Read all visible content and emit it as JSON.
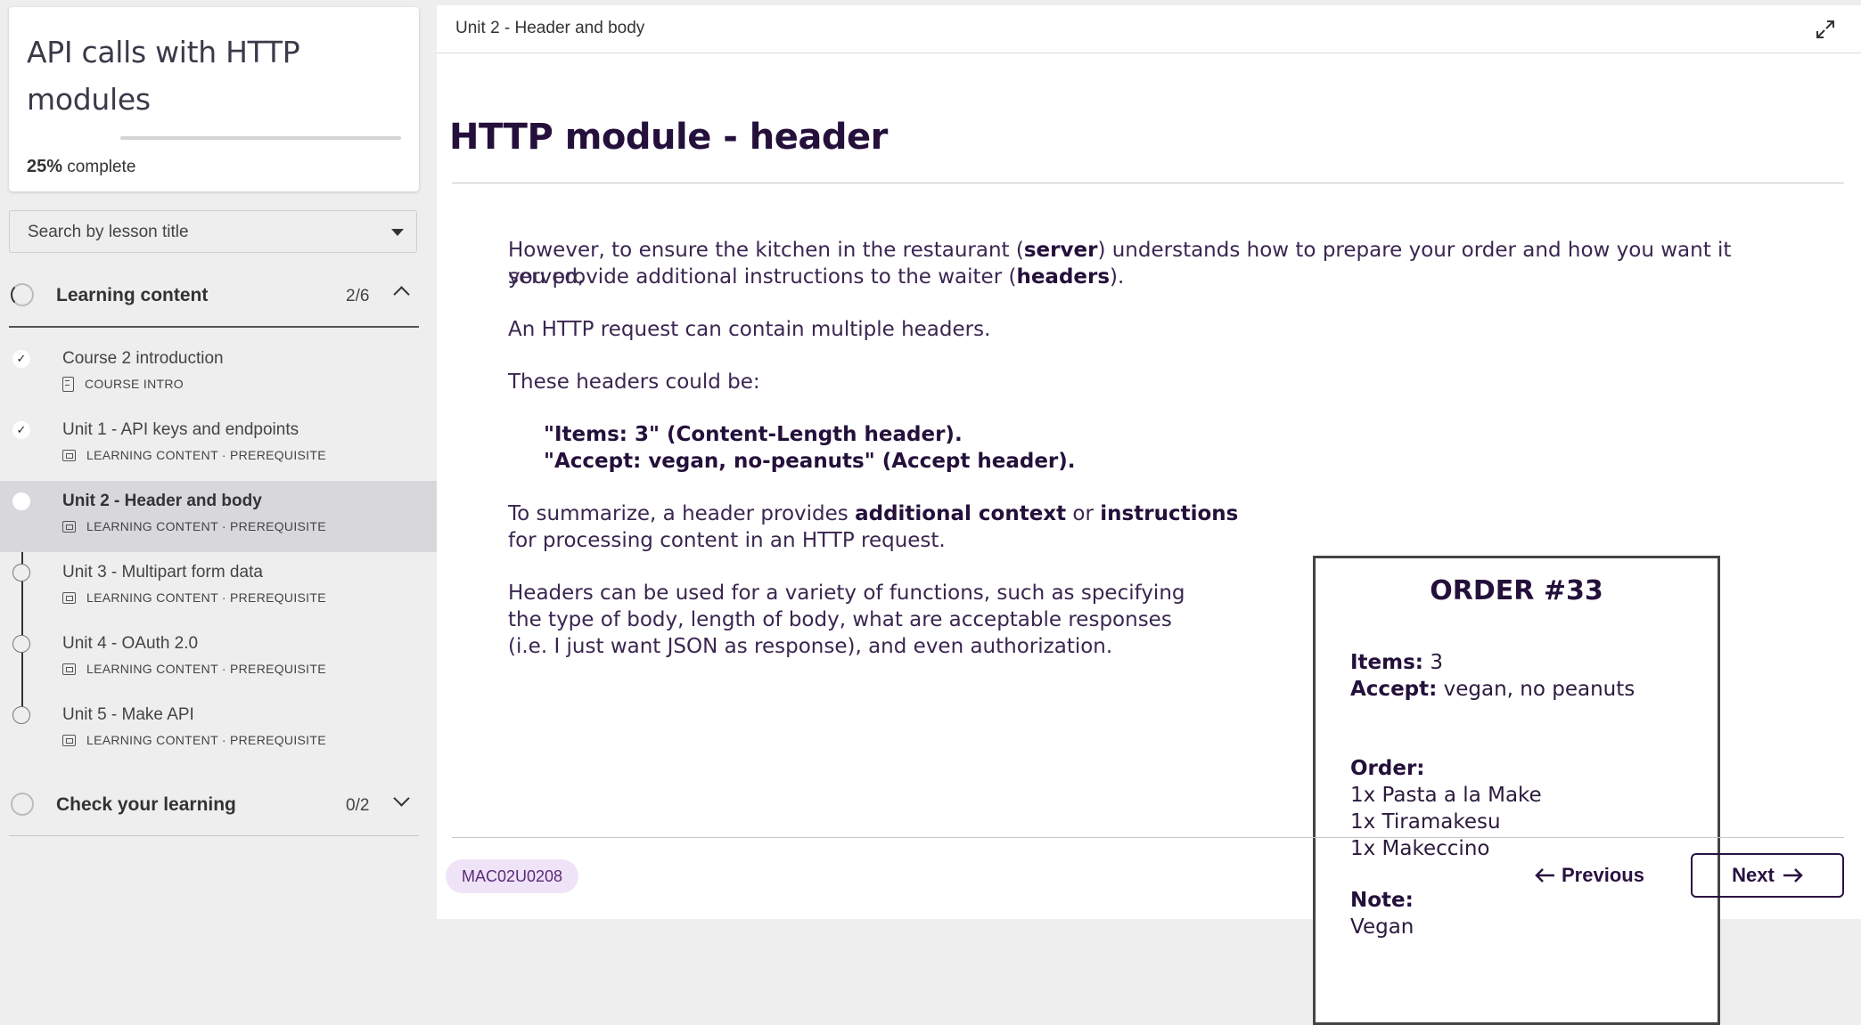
{
  "sidebar": {
    "course_title": "API calls with HTTP modules",
    "progress": {
      "percent_label": "25%",
      "suffix": " complete",
      "value": 0.25
    },
    "search": {
      "placeholder": "Search by lesson title"
    },
    "sections": [
      {
        "label": "Learning content",
        "count": "2/6",
        "expanded": true,
        "lessons": [
          {
            "title": "Course 2 introduction",
            "meta": "COURSE INTRO",
            "status": "completed",
            "icon": "document-icon"
          },
          {
            "title": "Unit 1 - API keys and endpoints",
            "meta": "LEARNING CONTENT · PREREQUISITE",
            "status": "completed",
            "icon": "slides-icon"
          },
          {
            "title": "Unit 2 - Header and body",
            "meta": "LEARNING CONTENT · PREREQUISITE",
            "status": "current",
            "icon": "slides-icon"
          },
          {
            "title": "Unit 3 - Multipart form data",
            "meta": "LEARNING CONTENT · PREREQUISITE",
            "status": "not-started",
            "icon": "slides-icon"
          },
          {
            "title": "Unit 4 - OAuth 2.0",
            "meta": "LEARNING CONTENT · PREREQUISITE",
            "status": "not-started",
            "icon": "slides-icon"
          },
          {
            "title": "Unit 5 - Make API",
            "meta": "LEARNING CONTENT · PREREQUISITE",
            "status": "not-started",
            "icon": "slides-icon"
          }
        ]
      },
      {
        "label": "Check your learning",
        "count": "0/2",
        "expanded": false
      }
    ]
  },
  "main": {
    "breadcrumb": "Unit 2 - Header and body",
    "page_title": "HTTP module - header",
    "paragraphs": {
      "p1_a": "However, to ensure the kitchen in the restaurant (",
      "p1_b": "server",
      "p1_c": ") understands how to prepare your order and how you want it served,",
      "p1_d": "you provide additional instructions to the waiter (",
      "p1_e": "headers",
      "p1_f": ").",
      "p2": "An HTTP request can contain multiple headers.",
      "p3": "These headers could be:",
      "h1": "\"Items: 3\" (Content-Length header).",
      "h2": "\"Accept: vegan, no-peanuts\" (Accept header).",
      "p4_a": "To summarize, a header provides ",
      "p4_b": "additional context",
      "p4_c": " or ",
      "p4_d": "instructions",
      "p4_e": "for processing content in an HTTP request.",
      "p5_1": "Headers can be used for a variety of functions, such as specifying",
      "p5_2": "the type of body, length of body, what are acceptable responses",
      "p5_3": "(i.e. I just want JSON as response), and even authorization."
    },
    "order_card": {
      "title": "ORDER #33",
      "items_label": "Items:",
      "items_value": " 3",
      "accept_label": "Accept:",
      "accept_value": " vegan, no peanuts",
      "order_label": "Order:",
      "order_lines": [
        "1x Pasta a la Make",
        "1x Tiramakesu",
        "1x Makeccino"
      ],
      "note_label": "Note:",
      "note_value": "Vegan"
    },
    "footer": {
      "code": "MAC02U0208",
      "previous_label": "Previous",
      "next_label": "Next"
    }
  },
  "colors": {
    "accent_dark": "#24103b",
    "badge_bg": "#efe3f7",
    "active_lesson_bg": "#d8d8dc"
  }
}
